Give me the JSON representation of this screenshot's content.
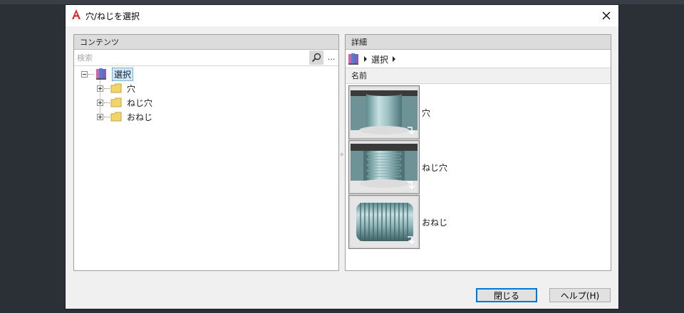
{
  "window": {
    "title": "穴/ねじを選択"
  },
  "contents_panel": {
    "header": "コンテンツ",
    "search": {
      "placeholder": "検索",
      "value": "",
      "more_label": "..."
    },
    "tree": {
      "root": {
        "label": "選択",
        "icon": "library-book-icon",
        "expanded": true,
        "selected": true
      },
      "children": [
        {
          "label": "穴",
          "icon": "folder-icon",
          "expanded": false
        },
        {
          "label": "ねじ穴",
          "icon": "folder-icon",
          "expanded": false
        },
        {
          "label": "おねじ",
          "icon": "folder-icon",
          "expanded": false
        }
      ]
    }
  },
  "details_panel": {
    "header": "詳細",
    "breadcrumb": {
      "icon": "library-book-icon",
      "items": [
        "選択"
      ]
    },
    "column_header": "名前",
    "items": [
      {
        "label": "穴",
        "thumbnail": "plain-hole-thumbnail"
      },
      {
        "label": "ねじ穴",
        "thumbnail": "tapped-hole-thumbnail"
      },
      {
        "label": "おねじ",
        "thumbnail": "external-thread-thumbnail"
      }
    ]
  },
  "buttons": {
    "close": "閉じる",
    "help": "ヘルプ(H)"
  },
  "colors": {
    "accent": "#0078d7",
    "selection": "#cce8ff",
    "app_icon_red": "#d42b2b",
    "folder_yellow": "#f2d46b"
  }
}
